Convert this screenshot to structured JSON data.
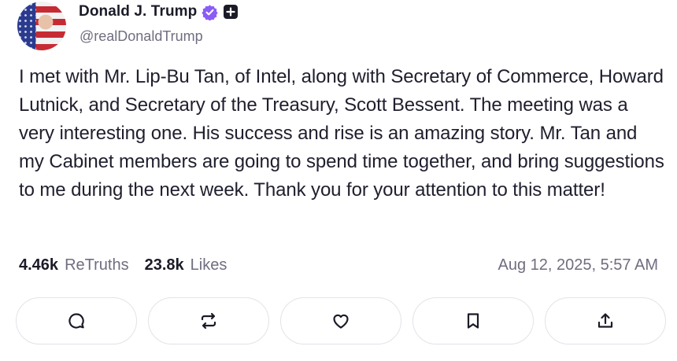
{
  "author": {
    "display_name": "Donald J. Trump",
    "handle": "@realDonaldTrump",
    "avatar_icon": "avatar-flag-portrait",
    "verified_icon": "verified-badge-icon",
    "subscribe_icon": "plus-icon",
    "accent_color": "#8b5cf6"
  },
  "post": {
    "text": "I met with Mr. Lip-Bu Tan, of Intel, along with Secretary of Commerce, Howard Lutnick, and Secretary of the Treasury, Scott Bessent. The meeting was a very interesting one. His success and rise is an amazing story. Mr. Tan and my Cabinet members are going to spend time together, and bring suggestions to me during the next week. Thank you for your attention to this matter!",
    "retruths_count": "4.46k",
    "retruths_label": "ReTruths",
    "likes_count": "23.8k",
    "likes_label": "Likes",
    "timestamp": "Aug 12, 2025, 5:57 AM"
  },
  "actions": [
    {
      "icon": "reply-icon"
    },
    {
      "icon": "retruth-icon"
    },
    {
      "icon": "like-icon"
    },
    {
      "icon": "bookmark-icon"
    },
    {
      "icon": "share-icon"
    }
  ]
}
